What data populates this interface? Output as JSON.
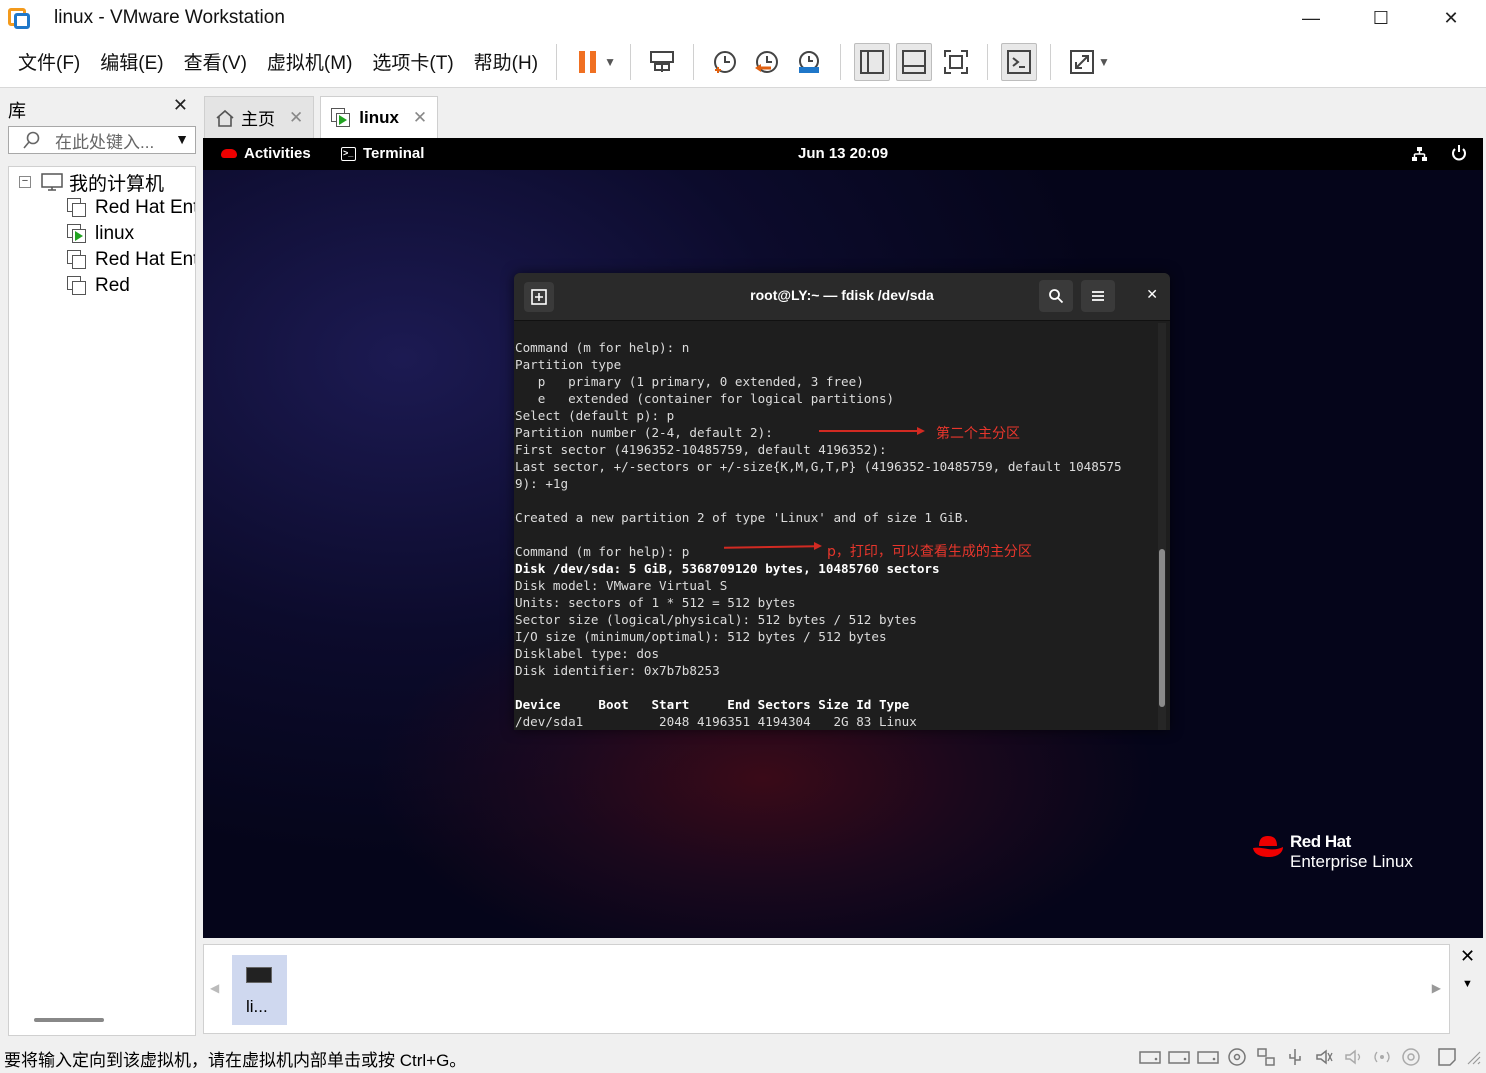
{
  "window": {
    "title": "linux - VMware Workstation",
    "minimize": "—",
    "maximize": "☐",
    "close": "✕"
  },
  "menu": [
    "文件(F)",
    "编辑(E)",
    "查看(V)",
    "虚拟机(M)",
    "选项卡(T)",
    "帮助(H)"
  ],
  "toolbar_icons": [
    "pause-icon",
    "send-ctrl-alt-del-icon",
    "snapshot-take-icon",
    "snapshot-revert-icon",
    "snapshot-manager-icon",
    "library-view-icon",
    "thumbnail-view-icon",
    "fullscreen-icon",
    "console-view-icon",
    "stretch-icon"
  ],
  "library": {
    "title": "库",
    "close": "✕",
    "search_placeholder": "在此处键入...",
    "root": "我的计算机",
    "items": [
      {
        "label": "Red Hat Ent",
        "running": false
      },
      {
        "label": "linux",
        "running": true
      },
      {
        "label": "Red Hat Ent",
        "running": false
      },
      {
        "label": "Red",
        "running": false
      }
    ]
  },
  "tabs": [
    {
      "label": "主页",
      "icon": "home-icon",
      "active": false
    },
    {
      "label": "linux",
      "icon": "vm-running-icon",
      "active": true
    }
  ],
  "gnome": {
    "activities": "Activities",
    "app": "Terminal",
    "clock": "Jun 13  20:09"
  },
  "terminal": {
    "title": "root@LY:~ — fdisk /dev/sda",
    "lines": [
      {
        "text": "Command (m for help): n",
        "bold": false
      },
      {
        "text": "Partition type",
        "bold": false
      },
      {
        "text": "   p   primary (1 primary, 0 extended, 3 free)",
        "bold": false
      },
      {
        "text": "   e   extended (container for logical partitions)",
        "bold": false
      },
      {
        "text": "Select (default p): p",
        "bold": false
      },
      {
        "text": "Partition number (2-4, default 2):",
        "bold": false
      },
      {
        "text": "First sector (4196352-10485759, default 4196352):",
        "bold": false
      },
      {
        "text": "Last sector, +/-sectors or +/-size{K,M,G,T,P} (4196352-10485759, default 1048575",
        "bold": false
      },
      {
        "text": "9): +1g",
        "bold": false
      },
      {
        "text": "",
        "bold": false
      },
      {
        "text": "Created a new partition 2 of type 'Linux' and of size 1 GiB.",
        "bold": false
      },
      {
        "text": "",
        "bold": false
      },
      {
        "text": "Command (m for help): p",
        "bold": false
      },
      {
        "text": "Disk /dev/sda: 5 GiB, 5368709120 bytes, 10485760 sectors",
        "bold": true
      },
      {
        "text": "Disk model: VMware Virtual S",
        "bold": false
      },
      {
        "text": "Units: sectors of 1 * 512 = 512 bytes",
        "bold": false
      },
      {
        "text": "Sector size (logical/physical): 512 bytes / 512 bytes",
        "bold": false
      },
      {
        "text": "I/O size (minimum/optimal): 512 bytes / 512 bytes",
        "bold": false
      },
      {
        "text": "Disklabel type: dos",
        "bold": false
      },
      {
        "text": "Disk identifier: 0x7b7b8253",
        "bold": false
      },
      {
        "text": "",
        "bold": false
      },
      {
        "text": "Device     Boot   Start     End Sectors Size Id Type",
        "bold": true
      },
      {
        "text": "/dev/sda1          2048 4196351 4194304   2G 83 Linux",
        "bold": false
      }
    ],
    "annotation_1": "第二个主分区",
    "annotation_2": "p，打印，可以查看生成的主分区"
  },
  "redhat_logo": {
    "line1": "Red Hat",
    "line2": "Enterprise Linux"
  },
  "thumbnail": {
    "label": "li...",
    "prev": "◀",
    "next": "▶"
  },
  "side_close": "✕",
  "side_dropdown": "▼",
  "status": {
    "text": "要将输入定向到该虚拟机，请在虚拟机内部单击或按 Ctrl+G。",
    "icons": [
      "hdd-icon",
      "hdd-icon",
      "hdd-icon",
      "cdrom-icon",
      "network-icon",
      "usb-icon",
      "sound-icon",
      "sound-muted-icon",
      "wireless-icon",
      "printer-icon",
      "message-icon"
    ]
  },
  "colors": {
    "redhat_red": "#ee0000",
    "annotation_red": "#e8362c",
    "pause_orange": "#f07022",
    "vmware_blue": "#1f77c9"
  }
}
